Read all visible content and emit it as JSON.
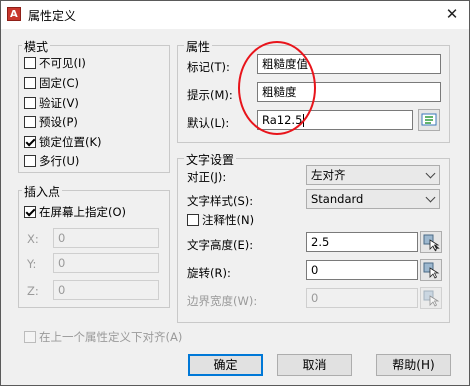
{
  "window": {
    "title": "属性定义",
    "close_glyph": "✕"
  },
  "mode": {
    "label": "模式",
    "invisible": {
      "label": "不可见(I)",
      "checked": false
    },
    "constant": {
      "label": "固定(C)",
      "checked": false
    },
    "verify": {
      "label": "验证(V)",
      "checked": false
    },
    "preset": {
      "label": "预设(P)",
      "checked": false
    },
    "lock_position": {
      "label": "锁定位置(K)",
      "checked": true
    },
    "multiline": {
      "label": "多行(U)",
      "checked": false
    }
  },
  "attribute": {
    "label": "属性",
    "tag_label": "标记(T):",
    "tag_value": "粗糙度值",
    "prompt_label": "提示(M):",
    "prompt_value": "粗糙度",
    "default_label": "默认(L):",
    "default_value": "Ra12.5",
    "insert_field_icon": "insert-field-icon"
  },
  "insertion": {
    "label": "插入点",
    "specify_on_screen": {
      "label": "在屏幕上指定(O)",
      "checked": true
    },
    "x_label": "X:",
    "x_value": "0",
    "y_label": "Y:",
    "y_value": "0",
    "z_label": "Z:",
    "z_value": "0"
  },
  "text": {
    "label": "文字设置",
    "justify_label": "对正(J):",
    "justify_value": "左对齐",
    "style_label": "文字样式(S):",
    "style_value": "Standard",
    "annotative": {
      "label": "注释性(N)",
      "checked": false
    },
    "height_label": "文字高度(E):",
    "height_value": "2.5",
    "rotation_label": "旋转(R):",
    "rotation_value": "0",
    "boundary_label": "边界宽度(W):",
    "boundary_value": "0",
    "pick_icon": "pick-point-icon"
  },
  "align_below": {
    "label": "在上一个属性定义下对齐(A)",
    "checked": false
  },
  "buttons": {
    "ok": "确定",
    "cancel": "取消",
    "help": "帮助(H)"
  },
  "colors": {
    "annotation_circle": "#e8141b",
    "accent": "#0078d7"
  }
}
